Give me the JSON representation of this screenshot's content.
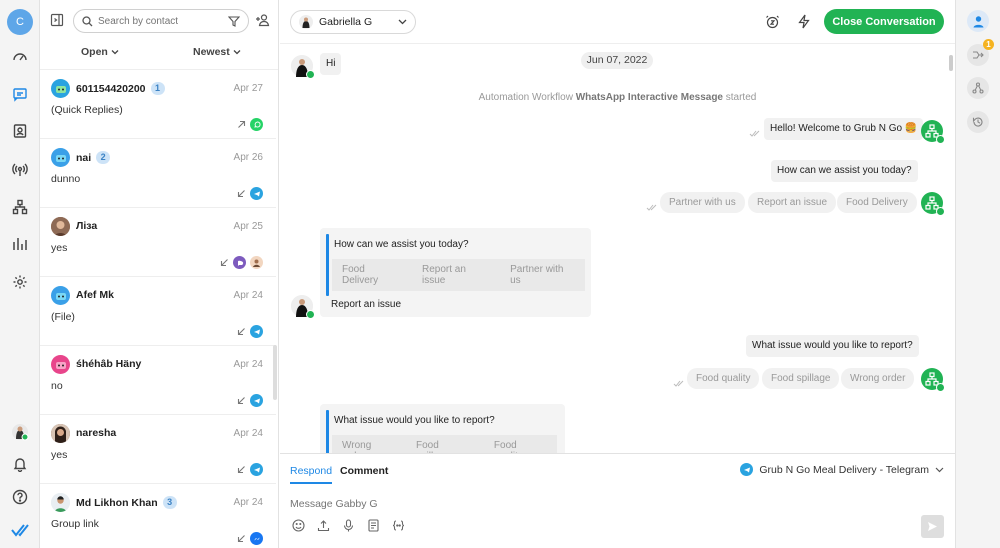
{
  "rail": {
    "user_initial": "C"
  },
  "list": {
    "search_placeholder": "Search by contact",
    "status_filter": "Open",
    "sort_filter": "Newest",
    "conversations": [
      {
        "name": "601154420200",
        "badge": "1",
        "date": "Apr 27",
        "message": "(Quick Replies)",
        "channel": "whatsapp",
        "avatar": "bot",
        "direction": "outgoing"
      },
      {
        "name": "nai",
        "badge": "2",
        "date": "Apr 26",
        "message": "dunno",
        "channel": "telegram",
        "avatar": "bot",
        "direction": "incoming"
      },
      {
        "name": "Ліза",
        "badge": "",
        "date": "Apr 25",
        "message": "yes",
        "channel": "viber",
        "avatar": "photo",
        "direction": "incoming"
      },
      {
        "name": "Afef Mk",
        "badge": "",
        "date": "Apr 24",
        "message": "(File)",
        "channel": "telegram",
        "avatar": "bot",
        "direction": "incoming"
      },
      {
        "name": "śhéhâb Häny",
        "badge": "",
        "date": "Apr 24",
        "message": "no",
        "channel": "telegram",
        "avatar": "bot-pink",
        "direction": "incoming"
      },
      {
        "name": "naresha",
        "badge": "",
        "date": "Apr 24",
        "message": "yes",
        "channel": "telegram",
        "avatar": "photo",
        "direction": "incoming"
      },
      {
        "name": "Md Likhon Khan",
        "badge": "3",
        "date": "Apr 24",
        "message": "Group link",
        "channel": "messenger",
        "avatar": "photo",
        "direction": "incoming"
      }
    ]
  },
  "header": {
    "contact_name": "Gabriella G",
    "close_label": "Close Conversation"
  },
  "chat": {
    "greeting": "Hi",
    "date": "Jun 07, 2022",
    "system_prefix": "Automation Workflow ",
    "system_bold": "WhatsApp Interactive Message",
    "system_suffix": " started",
    "welcome": "Hello! Welcome to Grub N Go 🍔",
    "assist_q": "How can we assist you today?",
    "chips1": [
      "Partner with us",
      "Report an issue",
      "Food Delivery"
    ],
    "card1_q": "How can we assist you today?",
    "card1_buttons": [
      "Food Delivery",
      "Report an issue",
      "Partner with us"
    ],
    "card1_reply": "Report an issue",
    "issue_q": "What issue would you like to report?",
    "chips2": [
      "Food quality",
      "Food spillage",
      "Wrong order"
    ],
    "card2_q": "What issue would you like to report?",
    "card2_buttons": [
      "Wrong order",
      "Food spillage",
      "Food quality"
    ]
  },
  "composer": {
    "tab_respond": "Respond",
    "tab_comment": "Comment",
    "channel": "Grub N Go Meal Delivery - Telegram",
    "placeholder": "Message Gabby G"
  },
  "right_rail": {
    "notification_count": "1"
  },
  "colors": {
    "accent": "#1e88e5",
    "green": "#21b354",
    "telegram": "#2aa3e0",
    "whatsapp": "#25d366",
    "viber": "#7d5bbe"
  }
}
